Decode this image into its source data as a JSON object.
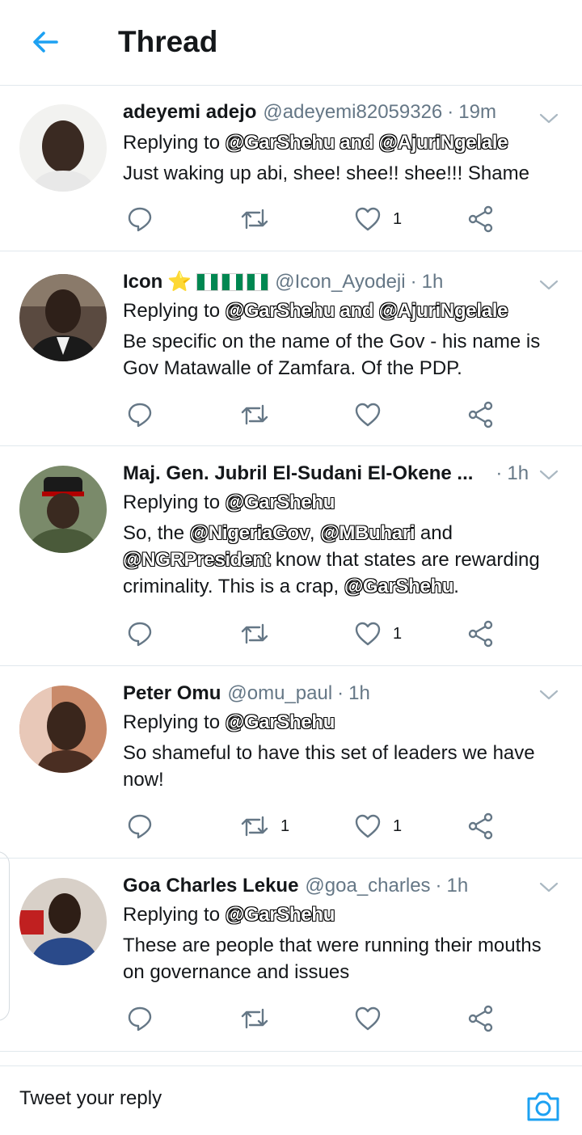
{
  "header": {
    "title": "Thread"
  },
  "colors": {
    "accent": "#1da1f2",
    "icon": "#657786",
    "flag_green": "#008751"
  },
  "tweets": [
    {
      "name": "adeyemi adejo",
      "handle": "@adeyemi82059326",
      "time": "19m",
      "replying_prefix": "Replying to",
      "replying_to": "@GarShehu and @AjuriNgelale",
      "text": "Just waking up abi, shee! shee!! shee!!! Shame",
      "retweets": "",
      "likes": "1"
    },
    {
      "name": "Icon",
      "name_emoji": "⭐",
      "flags": 3,
      "handle": "@Icon_Ayodeji",
      "time": "1h",
      "replying_prefix": "Replying to",
      "replying_to": "@GarShehu and @AjuriNgelale",
      "text": "Be specific on the name of the Gov - his name is Gov Matawalle of Zamfara. Of the PDP.",
      "retweets": "",
      "likes": ""
    },
    {
      "name": "Maj. Gen. Jubril El-Sudani El-Okene ...",
      "handle": "",
      "time": "1h",
      "replying_prefix": "Replying to",
      "replying_to": "@GarShehu",
      "text_parts": {
        "p1": "So, the ",
        "m1": "@NigeriaGov",
        "p2": ", ",
        "m2": "@MBuhari",
        "p3": " and ",
        "m3": "@NGRPresident",
        "p4": " know that states are rewarding criminality. This is a crap, ",
        "m4": "@GarShehu",
        "p5": "."
      },
      "retweets": "",
      "likes": "1"
    },
    {
      "name": "Peter Omu",
      "handle": "@omu_paul",
      "time": "1h",
      "replying_prefix": "Replying to",
      "replying_to": "@GarShehu",
      "text": "So shameful to have this set of leaders we have now!",
      "retweets": "1",
      "likes": "1"
    },
    {
      "name": "Goa Charles Lekue",
      "handle": "@goa_charles",
      "time": "1h",
      "replying_prefix": "Replying to",
      "replying_to": "@GarShehu",
      "text": "These are people that were running their mouths on governance and issues",
      "retweets": "",
      "likes": ""
    }
  ],
  "reply_bar": {
    "placeholder": "Tweet your reply"
  }
}
